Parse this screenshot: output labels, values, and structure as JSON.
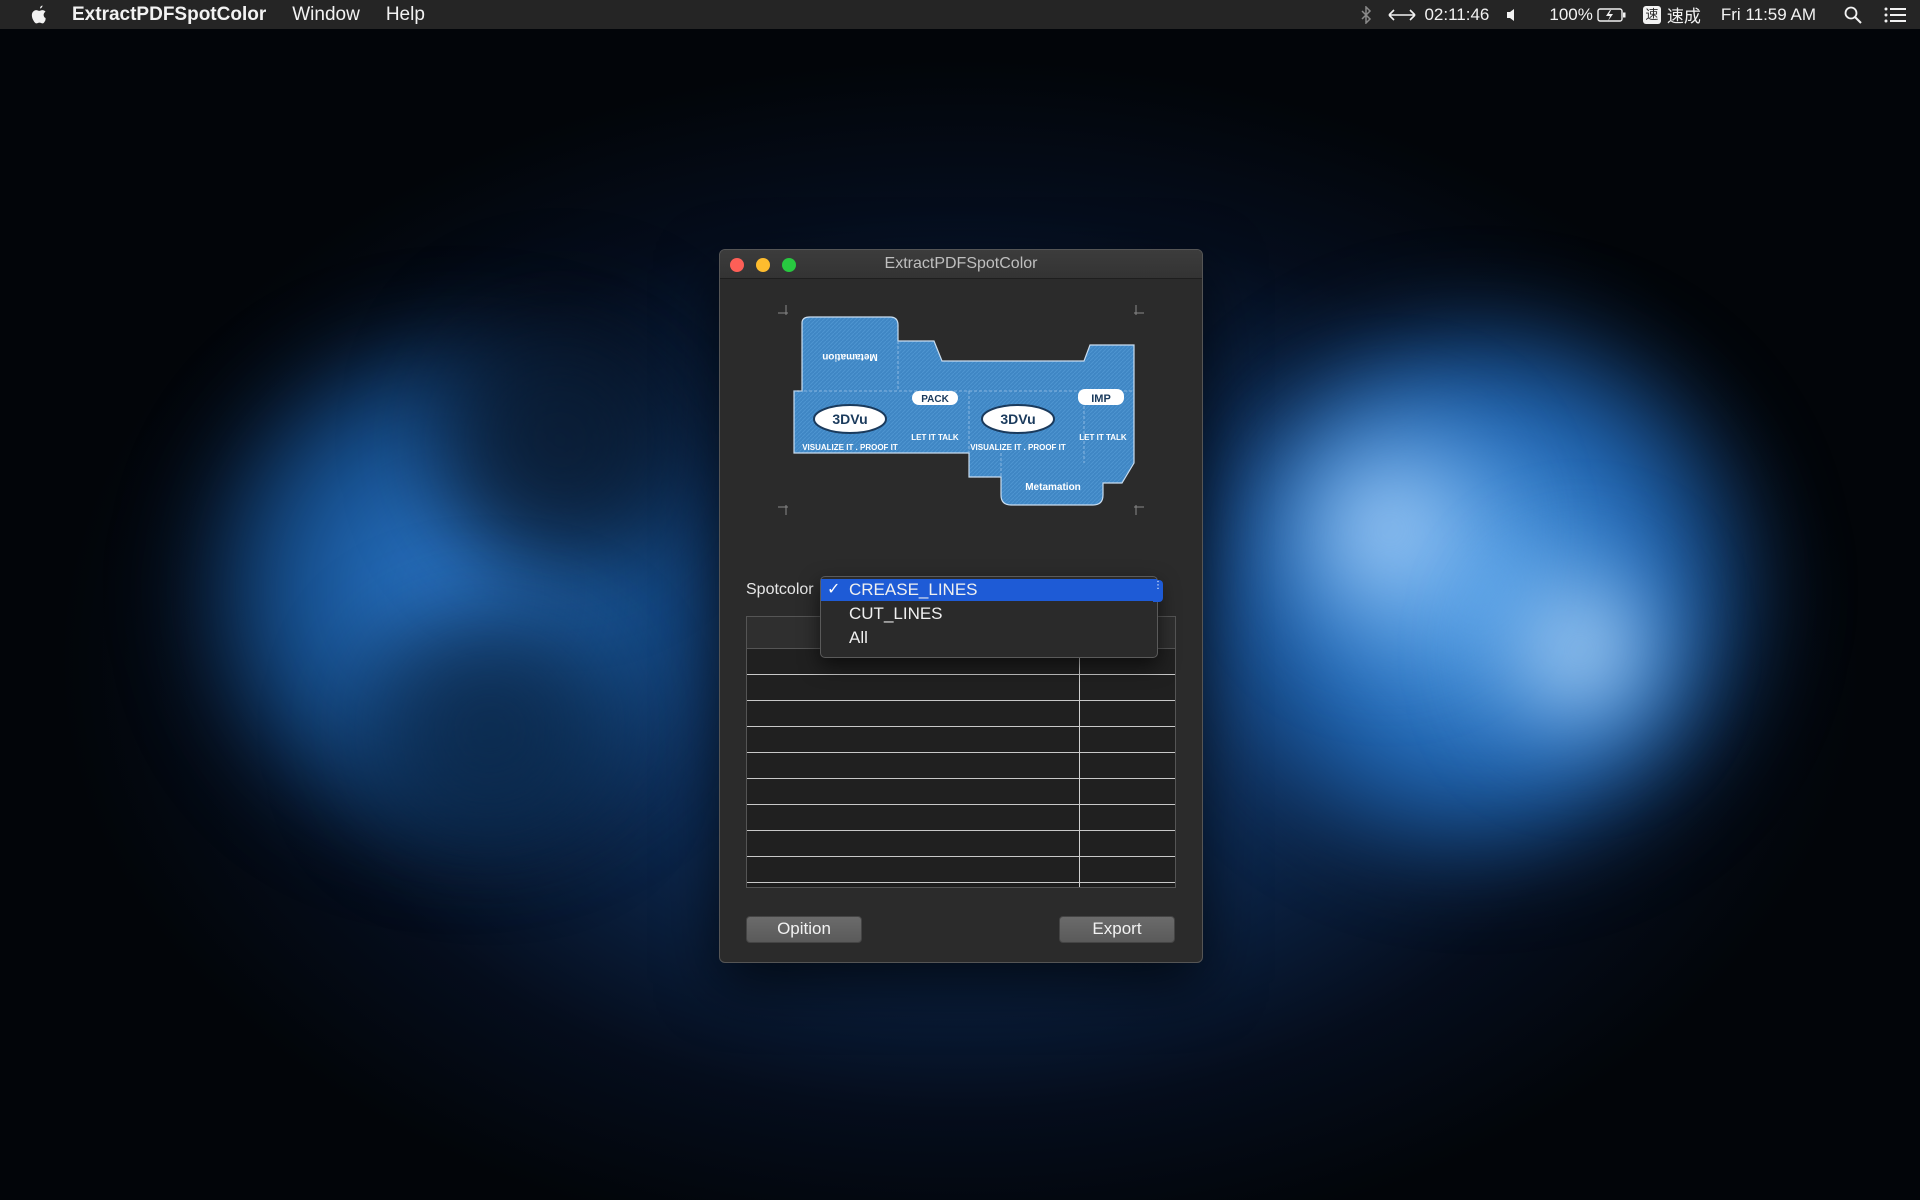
{
  "menubar": {
    "app_name": "ExtractPDFSpotColor",
    "items": [
      "Window",
      "Help"
    ],
    "status": {
      "timer": "02:11:46",
      "battery": "100%",
      "ime_box": "速",
      "ime_label": "速成",
      "clock": "Fri 11:59 AM"
    }
  },
  "window": {
    "title": "ExtractPDFSpotColor",
    "spotcolor_label": "Spotcolor",
    "option_button": "Opition",
    "export_button": "Export",
    "preview_texts": {
      "brand_top": "Metamation",
      "tag1": "VISUALIZE IT . PROOF IT",
      "tag2": "LET IT TALK",
      "pack": "PACK",
      "imp": "IMP",
      "logo": "3DVu",
      "brand_bottom": "Metamation"
    }
  },
  "dropdown": {
    "options": [
      "CREASE_LINES",
      "CUT_LINES",
      "All"
    ],
    "selected": "CREASE_LINES"
  },
  "colors": {
    "selection": "#1e5bd6",
    "window_bg": "#2b2b2b",
    "preview_blue": "#3f86c4"
  }
}
